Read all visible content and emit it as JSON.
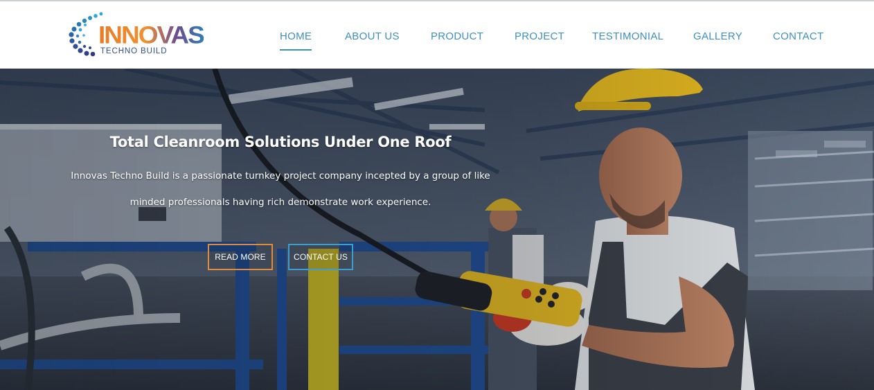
{
  "brand": {
    "name": "INNOVAS",
    "tagline": "TECHNO BUILD",
    "colors": {
      "orange": "#e77c28",
      "purple": "#6a4c93",
      "blue": "#2f7fb3",
      "nav": "#3c8fc0"
    }
  },
  "nav": {
    "items": [
      {
        "label": "HOME",
        "active": true
      },
      {
        "label": "ABOUT US"
      },
      {
        "label": "PRODUCT"
      },
      {
        "label": "PROJECT"
      },
      {
        "label": "TESTIMONIAL"
      },
      {
        "label": "GALLERY"
      },
      {
        "label": "CONTACT"
      }
    ]
  },
  "hero": {
    "title": "Total Cleanroom Solutions Under One Roof",
    "text_line1": "Innovas Techno Build is a passionate turnkey project company incepted by a group of like",
    "text_line2": "minded professionals having rich demonstrate work experience.",
    "read_more": "READ MORE",
    "contact_us": "CONTACT US",
    "image": "factory-worker-with-hard-hat-and-remote-control"
  }
}
